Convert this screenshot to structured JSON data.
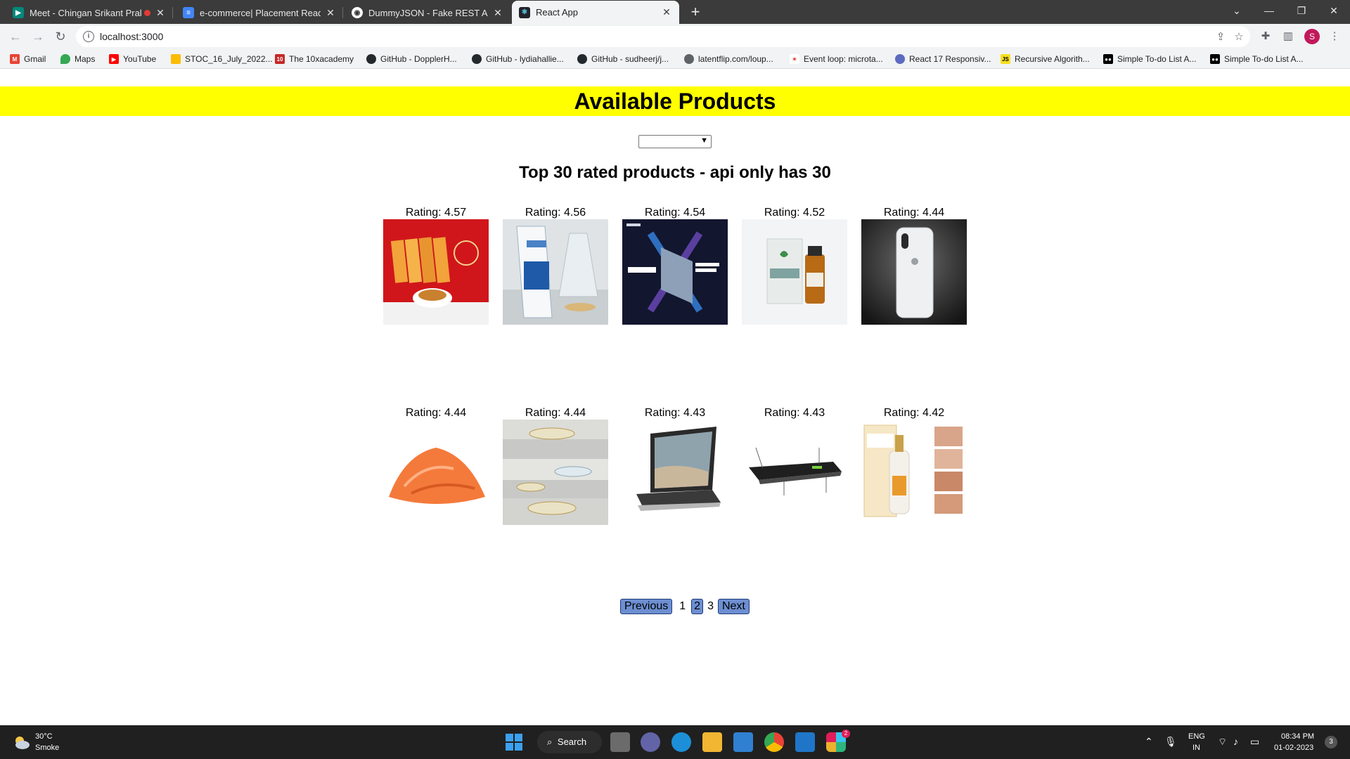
{
  "browser": {
    "tabs": [
      {
        "title": "Meet - Chingan Srikant Prak",
        "icon": "meet-icon",
        "color": "#00897b"
      },
      {
        "title": "e-commerce| Placement Readine",
        "icon": "docs-icon",
        "color": "#4285f4"
      },
      {
        "title": "DummyJSON - Fake REST API of",
        "icon": "dummyjson-icon",
        "color": "#ffffff"
      },
      {
        "title": "React App",
        "icon": "react-icon",
        "color": "#61dafb"
      }
    ],
    "url": "localhost:3000",
    "profile_initial": "S",
    "bookmarks": [
      "Gmail",
      "Maps",
      "YouTube",
      "STOC_16_July_2022...",
      "The 10xacademy",
      "GitHub - DopplerH...",
      "GitHub - lydiahallie...",
      "GitHub - sudheerj/j...",
      "latentflip.com/loup...",
      "Event loop: microta...",
      "React 17 Responsiv...",
      "Recursive Algorith...",
      "Simple To-do List A...",
      "Simple To-do List A..."
    ]
  },
  "page": {
    "heading": "Available Products",
    "banner_color": "#ffff00",
    "select_value": "",
    "subtitle": "Top 30 rated products - api only has 30",
    "products": [
      {
        "rating": "Rating: 4.57",
        "image": "snack-boxes-image"
      },
      {
        "rating": "Rating: 4.56",
        "image": "cream-tube-image"
      },
      {
        "rating": "Rating: 4.54",
        "image": "infinix-laptop-image"
      },
      {
        "rating": "Rating: 4.52",
        "image": "tea-tree-oil-image"
      },
      {
        "rating": "Rating: 4.44",
        "image": "iphone-back-image"
      },
      {
        "rating": "Rating: 4.44",
        "image": "orange-lentils-image"
      },
      {
        "rating": "Rating: 4.44",
        "image": "glass-dish-image"
      },
      {
        "rating": "Rating: 4.43",
        "image": "surface-laptop-image"
      },
      {
        "rating": "Rating: 4.43",
        "image": "black-laptop-image"
      },
      {
        "rating": "Rating: 4.42",
        "image": "white-rice-serum-image"
      }
    ],
    "pagination": {
      "previous": "Previous",
      "pages": [
        "1",
        "2",
        "3"
      ],
      "next": "Next",
      "button_color": "#6d8fd1"
    }
  },
  "taskbar": {
    "weather_temp": "30°C",
    "weather_desc": "Smoke",
    "search_label": "Search",
    "lang_top": "ENG",
    "lang_bottom": "IN",
    "time": "08:34 PM",
    "date": "01-02-2023",
    "notification_count": "3",
    "slack_badge": "2"
  }
}
